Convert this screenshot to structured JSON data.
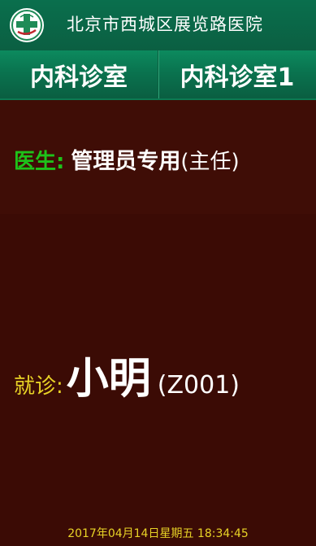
{
  "header": {
    "hospital_name": "北京市西城区展览路医院",
    "logo_icon": "hospital-cross-logo-icon"
  },
  "rooms": {
    "left": "内科诊室",
    "right": "内科诊室1"
  },
  "doctor": {
    "label": "医生:",
    "name": "管理员专用",
    "title": "(主任)"
  },
  "visit": {
    "label": "就诊:",
    "patient_name": "小明",
    "patient_code": "(Z001)"
  },
  "footer": {
    "datetime": "2017年04月14日星期五  18:34:45"
  },
  "colors": {
    "header_green": "#0b6b48",
    "background": "#3f0d06",
    "doctor_label": "#1ec21a",
    "visit_label": "#e8d326"
  }
}
